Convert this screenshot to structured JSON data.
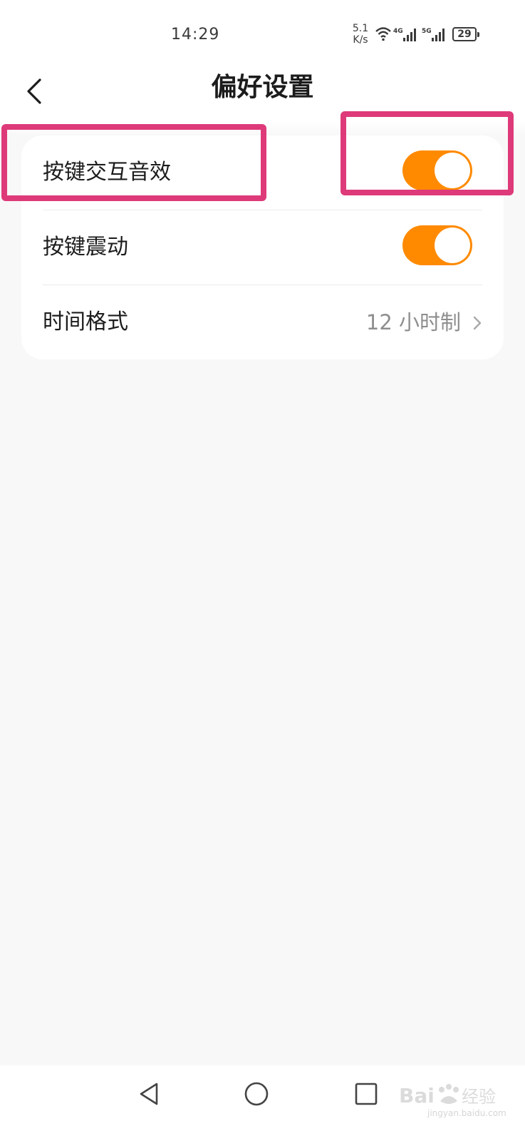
{
  "status_bar": {
    "time": "14:29",
    "net_speed_value": "5.1",
    "net_speed_unit": "K/s",
    "network_4g": "4G",
    "network_5g": "5G",
    "battery_level": "29"
  },
  "header": {
    "title": "偏好设置",
    "back_icon": "chevron-left-icon"
  },
  "settings": {
    "items": [
      {
        "label": "按键交互音效",
        "type": "toggle",
        "enabled": true
      },
      {
        "label": "按键震动",
        "type": "toggle",
        "enabled": true
      },
      {
        "label": "时间格式",
        "type": "select",
        "value": "12 小时制"
      }
    ]
  },
  "nav_bar": {
    "icons": [
      "triangle-back-icon",
      "circle-home-icon",
      "square-recent-icon"
    ]
  },
  "watermark": {
    "text": "jingyan.baidu.com"
  },
  "colors": {
    "accent": "#ff8a00",
    "annotation": "#de3a7a",
    "background": "#f8f8f8"
  }
}
